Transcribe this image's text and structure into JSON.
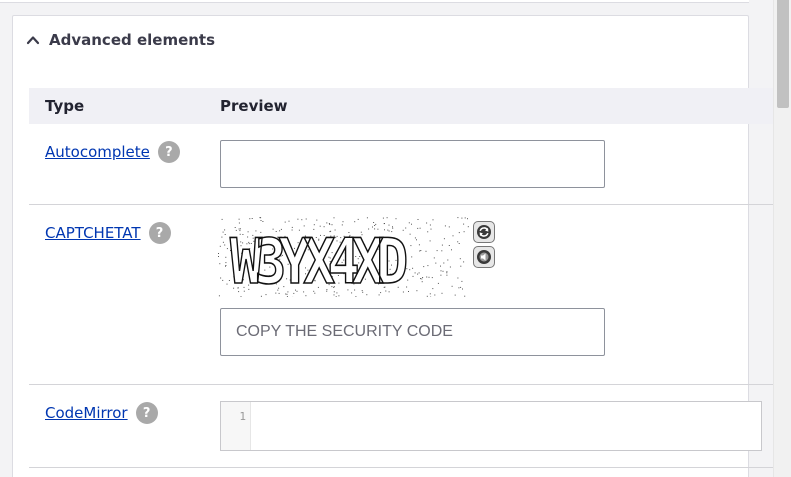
{
  "details": {
    "summary_label": "Advanced elements"
  },
  "table": {
    "headers": {
      "type": "Type",
      "preview": "Preview"
    },
    "rows": [
      {
        "type_label": "Autocomplete",
        "help": "?",
        "input_value": ""
      },
      {
        "type_label": "CAPTCHETAT",
        "help": "?",
        "captcha_text": "W3YX4XD",
        "placeholder": "COPY THE SECURITY CODE"
      },
      {
        "type_label": "CodeMirror",
        "help": "?",
        "line_number": "1"
      }
    ]
  },
  "icons": {
    "summary": "chevron-up-icon",
    "captcha_reload": "refresh-icon",
    "captcha_audio": "speaker-icon"
  }
}
